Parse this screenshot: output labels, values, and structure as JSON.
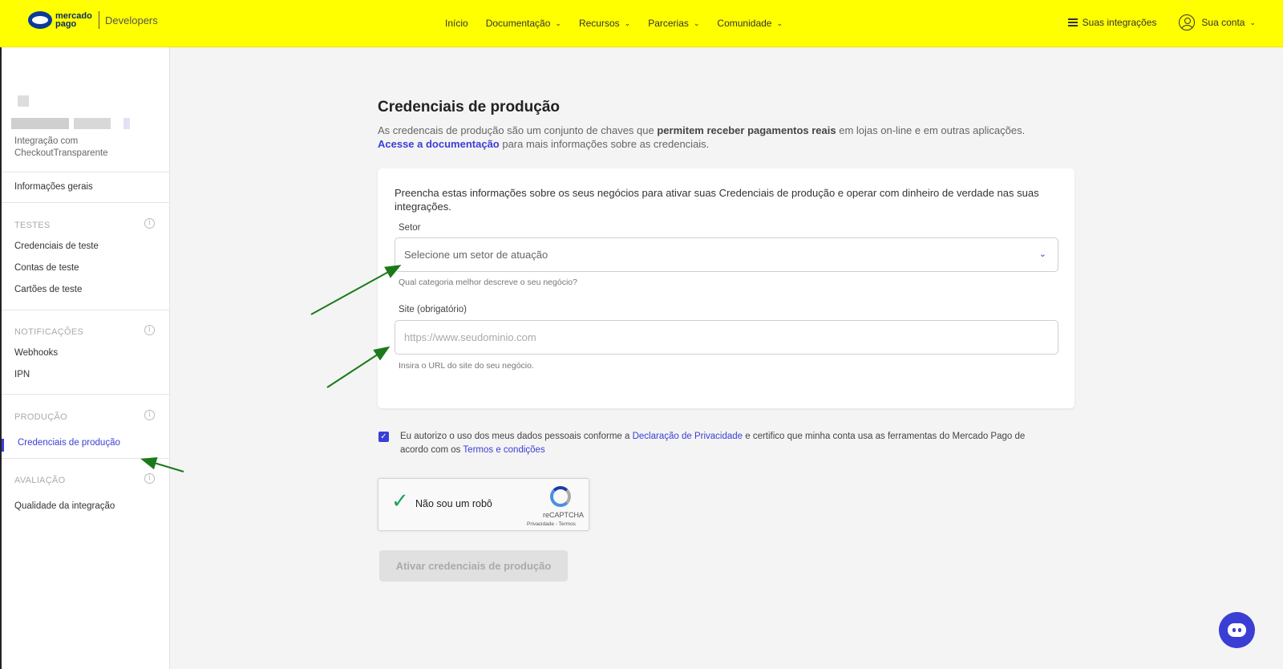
{
  "header": {
    "logo_line1": "mercado",
    "logo_line2": "pago",
    "logo_sub": "Developers",
    "nav": [
      {
        "label": "Início"
      },
      {
        "label": "Documentação"
      },
      {
        "label": "Recursos"
      },
      {
        "label": "Parcerias"
      },
      {
        "label": "Comunidade"
      }
    ],
    "integrations_label": "Suas integrações",
    "account_label": "Sua conta"
  },
  "sidebar": {
    "app_description": "Integração com CheckoutTransparente",
    "general_info": "Informações gerais",
    "sections": {
      "tests": "TESTES",
      "notifications": "NOTIFICAÇÕES",
      "production": "PRODUÇÃO",
      "evaluation": "AVALIAÇÃO"
    },
    "items": {
      "test_credentials": "Credenciais de teste",
      "test_accounts": "Contas de teste",
      "test_cards": "Cartões de teste",
      "webhooks": "Webhooks",
      "ipn": "IPN",
      "production_credentials": "Credenciais de produção",
      "integration_quality": "Qualidade da integração"
    }
  },
  "main": {
    "title": "Credenciais de produção",
    "desc_part1": "As credencais de produção são um conjunto de chaves que ",
    "desc_bold": "permitem receber pagamentos reais",
    "desc_part2": " em lojas on-line e em outras aplicações.",
    "desc_link": "Acesse a documentação",
    "desc_part3": " para mais informações sobre as credenciais.",
    "card_intro": "Preencha estas informações sobre os seus negócios para ativar suas Credenciais de produção e operar com dinheiro de verdade nas suas integrações.",
    "sector_label": "Setor",
    "sector_placeholder": "Selecione um setor de atuação",
    "sector_helper": "Qual categoria melhor descreve o seu negócio?",
    "site_label": "Site (obrigatório)",
    "site_placeholder": "https://www.seudominio.com",
    "site_helper": "Insira o URL do site do seu negócio.",
    "consent_part1": "Eu autorizo o uso dos meus dados pessoais conforme a ",
    "consent_link1": "Declaração de Privacidade",
    "consent_part2": " e certifico que minha conta usa as ferramentas do Mercado Pago de acordo com os ",
    "consent_link2": "Termos e condições",
    "consent_checked": true,
    "recaptcha_label": "Não sou um robô",
    "recaptcha_brand": "reCAPTCHA",
    "recaptcha_terms": "Privacidade - Termos",
    "submit_label": "Ativar credenciais de produção"
  },
  "colors": {
    "header_bg": "#ffff00",
    "accent": "#3b3ed4",
    "annotation_arrow": "#1a7a1a"
  }
}
